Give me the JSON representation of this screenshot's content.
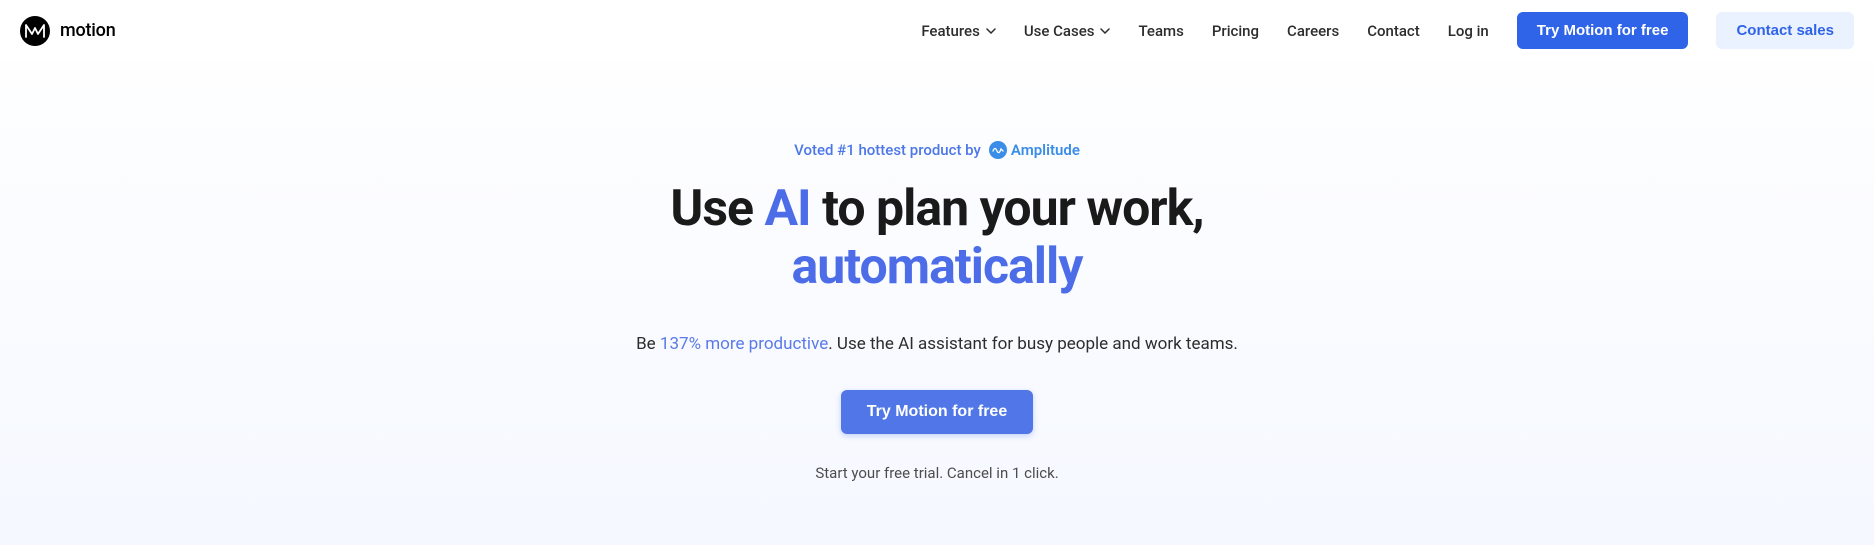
{
  "brand": {
    "name": "motion"
  },
  "nav": {
    "features": "Features",
    "useCases": "Use Cases",
    "teams": "Teams",
    "pricing": "Pricing",
    "careers": "Careers",
    "contact": "Contact",
    "login": "Log in",
    "tryFree": "Try Motion for free",
    "contactSales": "Contact sales"
  },
  "hero": {
    "votedPrefix": "Voted #1 hottest product by",
    "amplitude": "Amplitude",
    "headline1a": "Use ",
    "headline1b": "AI",
    "headline1c": " to plan your work,",
    "headline2": "automatically",
    "subtextPrefix": "Be ",
    "subtextAccent": "137% more productive",
    "subtextSuffix": ". Use the AI assistant for busy people and work teams.",
    "ctaButton": "Try Motion for free",
    "trialText": "Start your free trial. Cancel in 1 click."
  }
}
